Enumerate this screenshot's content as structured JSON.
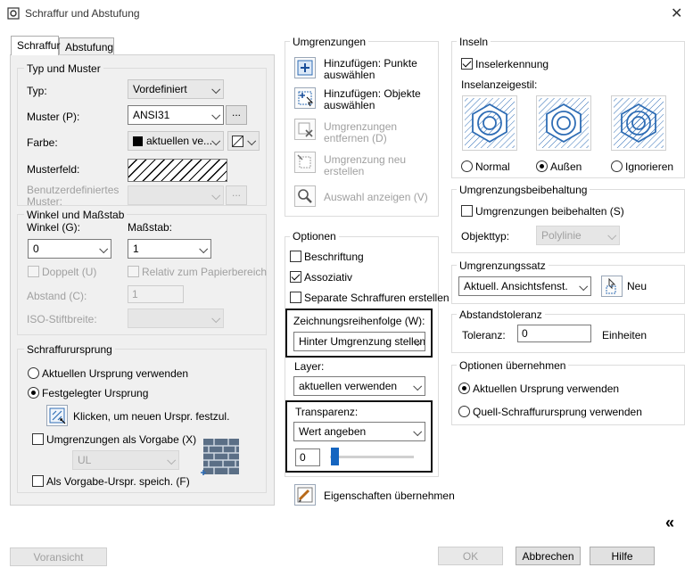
{
  "window": {
    "title": "Schraffur und Abstufung",
    "close": "✕"
  },
  "tabs": [
    {
      "label": "Schraffur"
    },
    {
      "label": "Abstufung"
    }
  ],
  "typ_muster": {
    "legend": "Typ und Muster",
    "typ_label": "Typ:",
    "typ_value": "Vordefiniert",
    "muster_label": "Muster (P):",
    "muster_value": "ANSI31",
    "muster_btn": "...",
    "farbe_label": "Farbe:",
    "farbe_value": "aktuellen ve...",
    "musterfeld_label": "Musterfeld:",
    "benutzer_label_1": "Benutzerdefiniertes",
    "benutzer_label_2": "Muster:",
    "benutzer_btn": "..."
  },
  "winkel": {
    "legend": "Winkel und Maßstab",
    "winkel_label": "Winkel (G):",
    "winkel_value": "0",
    "massstab_label": "Maßstab:",
    "massstab_value": "1",
    "doppelt": "Doppelt (U)",
    "relativ": "Relativ zum Papierbereich",
    "abstand_label": "Abstand (C):",
    "abstand_value": "1",
    "iso_label": "ISO-Stiftbreite:"
  },
  "ursprung": {
    "legend": "Schraffurursprung",
    "aktuell": "Aktuellen Ursprung verwenden",
    "festgelegt": "Festgelegter Ursprung",
    "klicken": "Klicken, um neuen Urspr. festzul.",
    "vorgabe": "Umgrenzungen als Vorgabe (X)",
    "ul_value": "UL",
    "speich": "Als Vorgabe-Urspr. speich. (F)"
  },
  "umgrenzungen": {
    "legend": "Umgrenzungen",
    "punkte": [
      "Hinzufügen: Punkte",
      "auswählen"
    ],
    "objekte": [
      "Hinzufügen: Objekte",
      "auswählen"
    ],
    "entfernen": [
      "Umgrenzungen",
      "entfernen (D)"
    ],
    "neu": [
      "Umgrenzung neu",
      "erstellen"
    ],
    "anzeigen": "Auswahl anzeigen (V)"
  },
  "optionen": {
    "legend": "Optionen",
    "beschriftung": "Beschriftung",
    "assoziativ": "Assoziativ",
    "separate": "Separate Schraffuren erstellen",
    "zeichnung_label": "Zeichnungsreihenfolge (W):",
    "zeichnung_value": "Hinter Umgrenzung stellen",
    "layer_label": "Layer:",
    "layer_value": "aktuellen verwenden",
    "transparenz_label": "Transparenz:",
    "transparenz_value": "Wert angeben",
    "transparenz_number": "0",
    "transparenz_level": 0
  },
  "eigenschaften": "Eigenschaften übernehmen",
  "inseln": {
    "legend": "Inseln",
    "erkennung": "Inselerkennung",
    "stil_label": "Inselanzeigestil:",
    "normal": "Normal",
    "aussen": "Außen",
    "ignorieren": "Ignorieren"
  },
  "beibehaltung": {
    "legend": "Umgrenzungsbeibehaltung",
    "beibehalten": "Umgrenzungen beibehalten (S)",
    "objekttyp_label": "Objekttyp:",
    "objekttyp_value": "Polylinie"
  },
  "satz": {
    "legend": "Umgrenzungssatz",
    "value": "Aktuell. Ansichtsfenst.",
    "neu": "Neu"
  },
  "toleranz": {
    "legend": "Abstandstoleranz",
    "label": "Toleranz:",
    "value": "0",
    "unit": "Einheiten"
  },
  "uebernehmen": {
    "legend": "Optionen übernehmen",
    "aktuell": "Aktuellen Ursprung verwenden",
    "quell": "Quell-Schraffurursprung verwenden"
  },
  "footer": {
    "collapse": "«",
    "voransicht": "Voransicht",
    "ok": "OK",
    "abbrechen": "Abbrechen",
    "hilfe": "Hilfe"
  },
  "colors": {
    "highlight": "#111111",
    "slider": "#1565c0",
    "accent_icon": "#2f6db5"
  }
}
